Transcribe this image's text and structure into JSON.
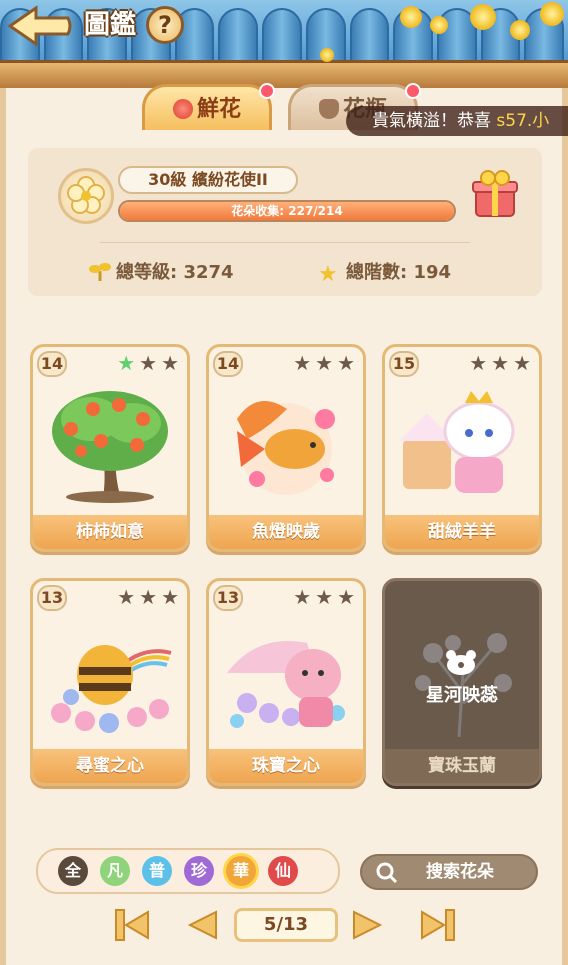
{
  "header": {
    "title": "圖鑑",
    "help_label": "?"
  },
  "tabs": [
    {
      "label": "鮮花",
      "active": true
    },
    {
      "label": "花瓶",
      "active": false
    }
  ],
  "marquee": {
    "text": "貴氣橫溢！恭喜 ",
    "highlight": "s57.小"
  },
  "summary": {
    "level_text": "30級  繽紛花使II",
    "collection_label": "花朵收集: 227/214",
    "collection_progress": 1.0,
    "total_level_label": "總等級: 3274",
    "total_stars_label": "總階數: 194"
  },
  "cards": [
    {
      "level": "14",
      "stars_on": 1,
      "name": "柿柿如意"
    },
    {
      "level": "14",
      "stars_on": 0,
      "name": "魚燈映歲"
    },
    {
      "level": "15",
      "stars_on": 0,
      "name": "甜絨羊羊"
    },
    {
      "level": "13",
      "stars_on": 0,
      "name": "尋蜜之心"
    },
    {
      "level": "13",
      "stars_on": 0,
      "name": "珠寶之心"
    },
    {
      "locked": true,
      "lock_title": "星河映蕊",
      "name": "寶珠玉蘭"
    }
  ],
  "filters": [
    {
      "label": "全",
      "color": "#5a4a3c",
      "selected": false
    },
    {
      "label": "凡",
      "color": "#8fd37a",
      "selected": false
    },
    {
      "label": "普",
      "color": "#5cc0e8",
      "selected": false
    },
    {
      "label": "珍",
      "color": "#a06ad6",
      "selected": false
    },
    {
      "label": "華",
      "color": "#f0a63a",
      "selected": true
    },
    {
      "label": "仙",
      "color": "#e04a4a",
      "selected": false
    }
  ],
  "search": {
    "label": "搜索花朵"
  },
  "pager": {
    "page_text": "5/13"
  },
  "colors": {
    "accent": "#f0a63a",
    "panel": "#f8efe1"
  }
}
